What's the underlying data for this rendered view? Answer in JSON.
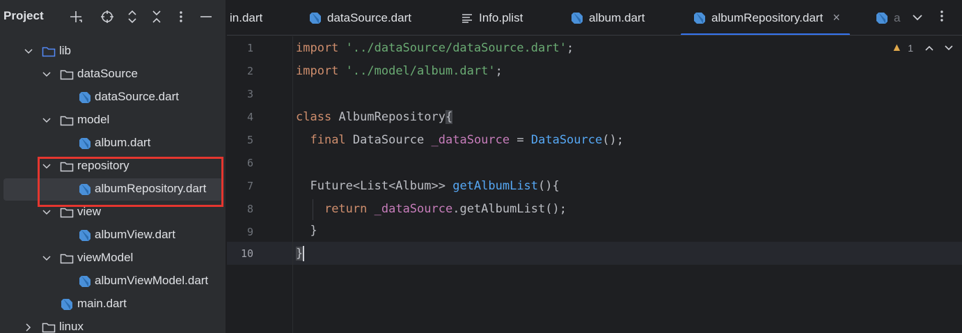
{
  "project_panel": {
    "title": "Project",
    "header_buttons": [
      {
        "name": "new-file-icon",
        "glyph": "+"
      },
      {
        "name": "locate-icon",
        "glyph": "⊕"
      },
      {
        "name": "expand-all-icon",
        "glyph": "⌃"
      },
      {
        "name": "collapse-all-icon",
        "glyph": "✕"
      },
      {
        "name": "more-options-icon",
        "glyph": "⋮"
      },
      {
        "name": "hide-panel-icon",
        "glyph": "—"
      }
    ],
    "tree": [
      {
        "label": "lib",
        "type": "folder",
        "expanded": true
      },
      {
        "label": "dataSource",
        "type": "folder",
        "expanded": true
      },
      {
        "label": "dataSource.dart",
        "type": "dart"
      },
      {
        "label": "model",
        "type": "folder",
        "expanded": true
      },
      {
        "label": "album.dart",
        "type": "dart"
      },
      {
        "label": "repository",
        "type": "folder",
        "expanded": true
      },
      {
        "label": "albumRepository.dart",
        "type": "dart",
        "selected": true
      },
      {
        "label": "view",
        "type": "folder",
        "expanded": true
      },
      {
        "label": "albumView.dart",
        "type": "dart"
      },
      {
        "label": "viewModel",
        "type": "folder",
        "expanded": true
      },
      {
        "label": "albumViewModel.dart",
        "type": "dart"
      },
      {
        "label": "main.dart",
        "type": "dart"
      },
      {
        "label": "linux",
        "type": "folder",
        "expanded": false
      }
    ]
  },
  "tabs": [
    {
      "label": "in.dart",
      "icon": "none"
    },
    {
      "label": "dataSource.dart",
      "icon": "dart"
    },
    {
      "label": "Info.plist",
      "icon": "text"
    },
    {
      "label": "album.dart",
      "icon": "dart"
    },
    {
      "label": "albumRepository.dart",
      "icon": "dart",
      "active": true,
      "close": "×"
    },
    {
      "label": "a",
      "icon": "dart"
    }
  ],
  "tab_overflow_icon": "⌄",
  "tab_menu_icon": "⋮",
  "inspection": {
    "warnings": "1",
    "warning_glyph": "▲",
    "prev_glyph": "⌃",
    "next_glyph": "⌄"
  },
  "editor": {
    "line_numbers": [
      "1",
      "2",
      "3",
      "4",
      "5",
      "6",
      "7",
      "8",
      "9",
      "10"
    ],
    "current_line": "10",
    "code": {
      "l1_kw": "import",
      "l1_str": "'../dataSource/dataSource.dart'",
      "l1_end": ";",
      "l2_kw": "import",
      "l2_str": "'../model/album.dart'",
      "l2_end": ";",
      "l4_kw": "class",
      "l4_name": "AlbumRepository",
      "l4_brace": "{",
      "l5_kw": "final",
      "l5_type": "DataSource",
      "l5_field": "_dataSource",
      "l5_eq": "=",
      "l5_ctor": "DataSource",
      "l5_end": "();",
      "l7_type": "Future<List<Album>>",
      "l7_fn": "getAlbumList",
      "l7_end": "(){",
      "l8_kw": "return",
      "l8_field": "_dataSource",
      "l8_call": ".getAlbumList();",
      "l9_brace": "}",
      "l10_brace": "}"
    }
  },
  "colors": {
    "accent": "#3574f0",
    "highlight_box": "#e5362f",
    "keyword": "#cf8e6d",
    "string": "#6aab73",
    "field": "#c77dbb",
    "function": "#56a8f5"
  }
}
